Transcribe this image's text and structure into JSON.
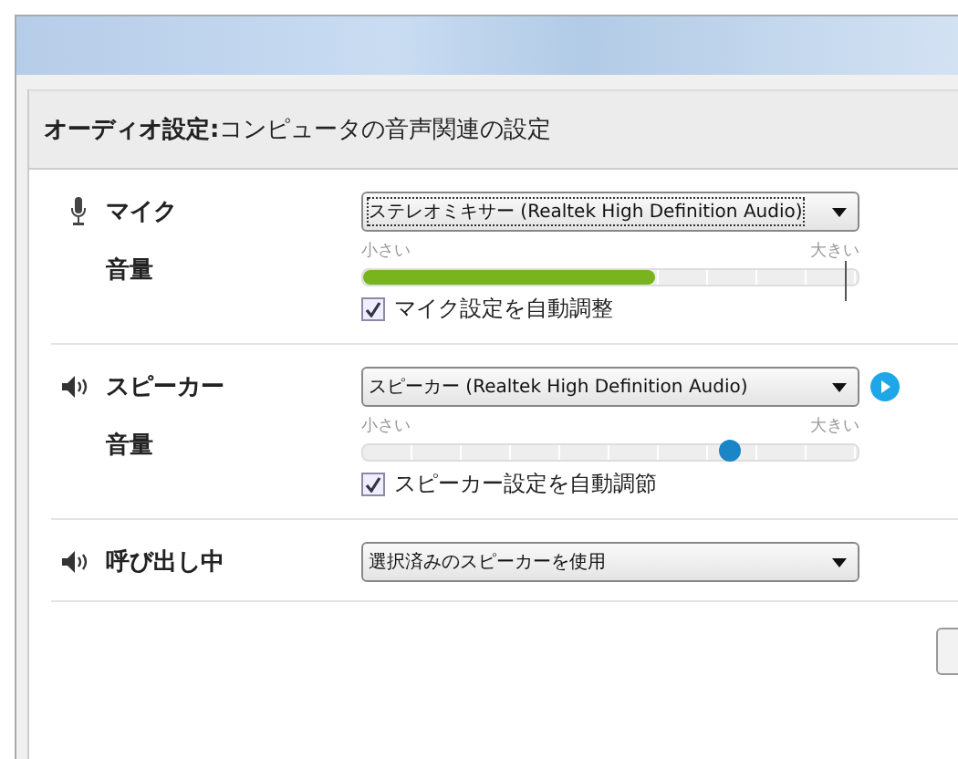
{
  "header": {
    "title": "オーディオ設定:",
    "subtitle": "コンピュータの音声関連の設定"
  },
  "sections": [
    {
      "kind": "mic",
      "label": "マイク",
      "device": "ステレオミキサー (Realtek High Definition Audio)",
      "focused": true,
      "play_button": false,
      "volume": {
        "label": "音量",
        "min_label": "小さい",
        "max_label": "大きい",
        "level": 0.59
      },
      "auto": {
        "label": "マイク設定を自動調整",
        "checked": true
      }
    },
    {
      "kind": "speaker",
      "label": "スピーカー",
      "device": "スピーカー (Realtek High Definition Audio)",
      "focused": false,
      "play_button": true,
      "volume": {
        "label": "音量",
        "min_label": "小さい",
        "max_label": "大きい",
        "level": 0.74
      },
      "auto": {
        "label": "スピーカー設定を自動調節",
        "checked": true
      }
    },
    {
      "kind": "speaker",
      "label": "呼び出し中",
      "device": "選択済みのスピーカーを使用",
      "focused": false,
      "play_button": false
    }
  ]
}
